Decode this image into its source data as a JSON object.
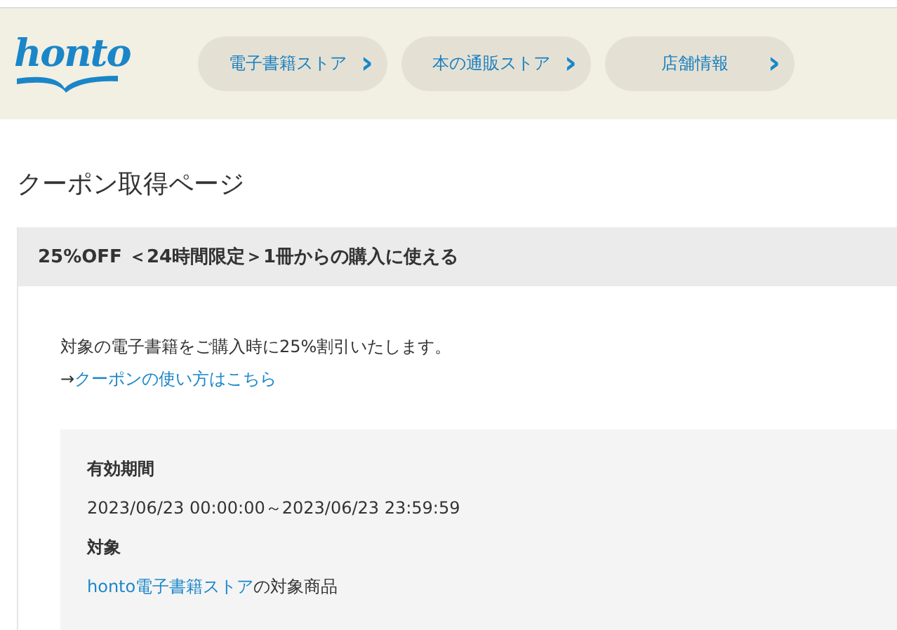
{
  "header": {
    "logo": "honto",
    "nav": [
      {
        "label": "電子書籍ストア",
        "icon": "›"
      },
      {
        "label": "本の通販ストア",
        "icon": "›"
      },
      {
        "label": "店舗情報",
        "icon": "›"
      }
    ]
  },
  "page_title": "クーポン取得ページ",
  "coupon": {
    "title": "25%OFF ＜24時間限定＞1冊からの購入に使える",
    "description": "対象の電子書籍をご購入時に25%割引いたします。",
    "help_arrow": "→",
    "help_link": "クーポンの使い方はこちら",
    "details": [
      {
        "label": "有効期間",
        "value": "2023/06/23 00:00:00～2023/06/23 23:59:59"
      },
      {
        "label": "対象",
        "link": "honto電子書籍ストア",
        "value": "の対象商品"
      }
    ]
  }
}
